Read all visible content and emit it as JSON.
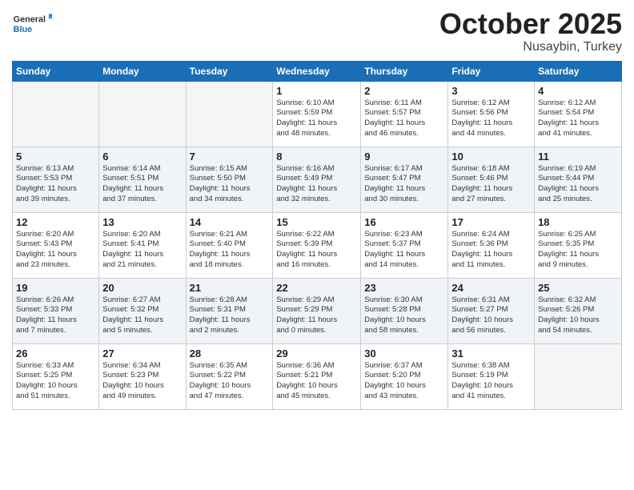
{
  "header": {
    "logo_general": "General",
    "logo_blue": "Blue",
    "month": "October 2025",
    "location": "Nusaybin, Turkey"
  },
  "weekdays": [
    "Sunday",
    "Monday",
    "Tuesday",
    "Wednesday",
    "Thursday",
    "Friday",
    "Saturday"
  ],
  "weeks": [
    [
      {
        "day": "",
        "info": ""
      },
      {
        "day": "",
        "info": ""
      },
      {
        "day": "",
        "info": ""
      },
      {
        "day": "1",
        "info": "Sunrise: 6:10 AM\nSunset: 5:59 PM\nDaylight: 11 hours\nand 48 minutes."
      },
      {
        "day": "2",
        "info": "Sunrise: 6:11 AM\nSunset: 5:57 PM\nDaylight: 11 hours\nand 46 minutes."
      },
      {
        "day": "3",
        "info": "Sunrise: 6:12 AM\nSunset: 5:56 PM\nDaylight: 11 hours\nand 44 minutes."
      },
      {
        "day": "4",
        "info": "Sunrise: 6:12 AM\nSunset: 5:54 PM\nDaylight: 11 hours\nand 41 minutes."
      }
    ],
    [
      {
        "day": "5",
        "info": "Sunrise: 6:13 AM\nSunset: 5:53 PM\nDaylight: 11 hours\nand 39 minutes."
      },
      {
        "day": "6",
        "info": "Sunrise: 6:14 AM\nSunset: 5:51 PM\nDaylight: 11 hours\nand 37 minutes."
      },
      {
        "day": "7",
        "info": "Sunrise: 6:15 AM\nSunset: 5:50 PM\nDaylight: 11 hours\nand 34 minutes."
      },
      {
        "day": "8",
        "info": "Sunrise: 6:16 AM\nSunset: 5:49 PM\nDaylight: 11 hours\nand 32 minutes."
      },
      {
        "day": "9",
        "info": "Sunrise: 6:17 AM\nSunset: 5:47 PM\nDaylight: 11 hours\nand 30 minutes."
      },
      {
        "day": "10",
        "info": "Sunrise: 6:18 AM\nSunset: 5:46 PM\nDaylight: 11 hours\nand 27 minutes."
      },
      {
        "day": "11",
        "info": "Sunrise: 6:19 AM\nSunset: 5:44 PM\nDaylight: 11 hours\nand 25 minutes."
      }
    ],
    [
      {
        "day": "12",
        "info": "Sunrise: 6:20 AM\nSunset: 5:43 PM\nDaylight: 11 hours\nand 23 minutes."
      },
      {
        "day": "13",
        "info": "Sunrise: 6:20 AM\nSunset: 5:41 PM\nDaylight: 11 hours\nand 21 minutes."
      },
      {
        "day": "14",
        "info": "Sunrise: 6:21 AM\nSunset: 5:40 PM\nDaylight: 11 hours\nand 18 minutes."
      },
      {
        "day": "15",
        "info": "Sunrise: 6:22 AM\nSunset: 5:39 PM\nDaylight: 11 hours\nand 16 minutes."
      },
      {
        "day": "16",
        "info": "Sunrise: 6:23 AM\nSunset: 5:37 PM\nDaylight: 11 hours\nand 14 minutes."
      },
      {
        "day": "17",
        "info": "Sunrise: 6:24 AM\nSunset: 5:36 PM\nDaylight: 11 hours\nand 11 minutes."
      },
      {
        "day": "18",
        "info": "Sunrise: 6:25 AM\nSunset: 5:35 PM\nDaylight: 11 hours\nand 9 minutes."
      }
    ],
    [
      {
        "day": "19",
        "info": "Sunrise: 6:26 AM\nSunset: 5:33 PM\nDaylight: 11 hours\nand 7 minutes."
      },
      {
        "day": "20",
        "info": "Sunrise: 6:27 AM\nSunset: 5:32 PM\nDaylight: 11 hours\nand 5 minutes."
      },
      {
        "day": "21",
        "info": "Sunrise: 6:28 AM\nSunset: 5:31 PM\nDaylight: 11 hours\nand 2 minutes."
      },
      {
        "day": "22",
        "info": "Sunrise: 6:29 AM\nSunset: 5:29 PM\nDaylight: 11 hours\nand 0 minutes."
      },
      {
        "day": "23",
        "info": "Sunrise: 6:30 AM\nSunset: 5:28 PM\nDaylight: 10 hours\nand 58 minutes."
      },
      {
        "day": "24",
        "info": "Sunrise: 6:31 AM\nSunset: 5:27 PM\nDaylight: 10 hours\nand 56 minutes."
      },
      {
        "day": "25",
        "info": "Sunrise: 6:32 AM\nSunset: 5:26 PM\nDaylight: 10 hours\nand 54 minutes."
      }
    ],
    [
      {
        "day": "26",
        "info": "Sunrise: 6:33 AM\nSunset: 5:25 PM\nDaylight: 10 hours\nand 51 minutes."
      },
      {
        "day": "27",
        "info": "Sunrise: 6:34 AM\nSunset: 5:23 PM\nDaylight: 10 hours\nand 49 minutes."
      },
      {
        "day": "28",
        "info": "Sunrise: 6:35 AM\nSunset: 5:22 PM\nDaylight: 10 hours\nand 47 minutes."
      },
      {
        "day": "29",
        "info": "Sunrise: 6:36 AM\nSunset: 5:21 PM\nDaylight: 10 hours\nand 45 minutes."
      },
      {
        "day": "30",
        "info": "Sunrise: 6:37 AM\nSunset: 5:20 PM\nDaylight: 10 hours\nand 43 minutes."
      },
      {
        "day": "31",
        "info": "Sunrise: 6:38 AM\nSunset: 5:19 PM\nDaylight: 10 hours\nand 41 minutes."
      },
      {
        "day": "",
        "info": ""
      }
    ]
  ]
}
